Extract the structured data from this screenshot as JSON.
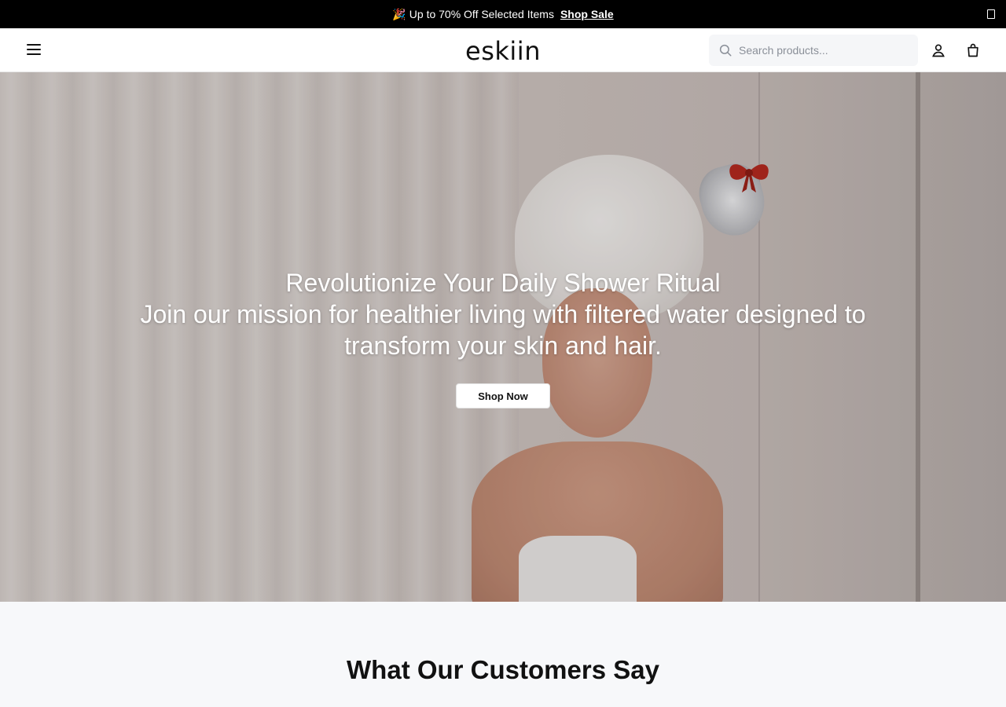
{
  "announcement": {
    "emoji": "🎉",
    "message": "Up to 70% Off Selected Items",
    "link_label": "Shop Sale"
  },
  "header": {
    "logo": "eskiin",
    "search_placeholder": "Search products..."
  },
  "hero": {
    "title": "Revolutionize Your Daily Shower Ritual",
    "subtitle": "Join our mission for healthier living with filtered water designed to transform your skin and hair.",
    "cta_label": "Shop Now"
  },
  "testimonials": {
    "heading": "What Our Customers Say"
  },
  "colors": {
    "announcement_bg": "#000000",
    "bow": "#b52a1f"
  }
}
